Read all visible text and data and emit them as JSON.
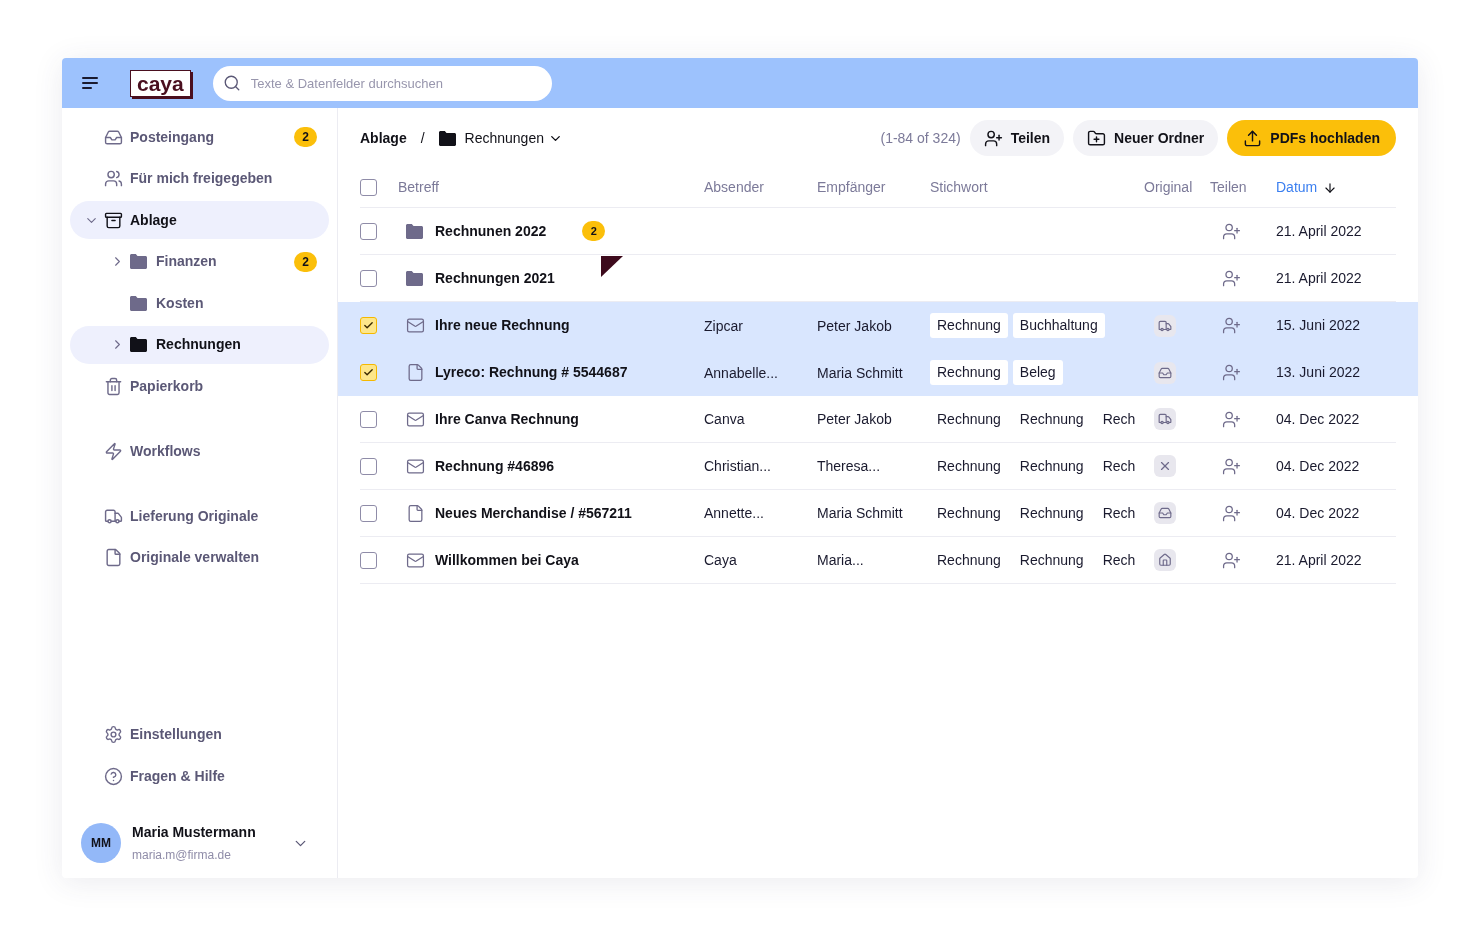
{
  "header": {
    "logo": "caya",
    "search": {
      "placeholder": "Texte & Datenfelder durchsuchen"
    }
  },
  "sidebar": {
    "sections": [
      {
        "items": [
          {
            "kind": "inbox",
            "label": "Posteingang",
            "badge": "2",
            "selected": false
          },
          {
            "kind": "users",
            "label": "Für mich freigegeben",
            "selected": false
          },
          {
            "kind": "archive",
            "label": "Ablage",
            "selected": true,
            "expanded": true,
            "children": [
              {
                "kind": "folder",
                "label": "Finanzen",
                "badge": "2",
                "selected": false,
                "expanded": false
              },
              {
                "kind": "folder",
                "label": "Kosten",
                "selected": false
              },
              {
                "kind": "folder",
                "label": "Rechnungen",
                "selected": true,
                "expanded": false
              }
            ]
          },
          {
            "kind": "trash",
            "label": "Papierkorb",
            "selected": false
          }
        ]
      },
      {
        "items": [
          {
            "kind": "bolt",
            "label": "Workflows",
            "selected": false
          }
        ]
      },
      {
        "items": [
          {
            "kind": "truck",
            "label": "Lieferung Originale",
            "selected": false
          },
          {
            "kind": "file",
            "label": "Originale verwalten",
            "selected": false
          }
        ]
      },
      {
        "items": [
          {
            "kind": "settings",
            "label": "Einstellungen",
            "selected": false
          },
          {
            "kind": "help",
            "label": "Fragen & Hilfe",
            "selected": false
          }
        ],
        "kind": "footer"
      }
    ],
    "user": {
      "initials": "MM",
      "name": "Maria Mustermann",
      "email": "maria.m@firma.de"
    }
  },
  "breadcrumb": {
    "root": "Ablage",
    "separator": "/",
    "current": "Rechnungen"
  },
  "count": "(1-84 of 324)",
  "actions": [
    {
      "kind": "share",
      "label": "Teilen"
    },
    {
      "kind": "new-folder",
      "label": "Neuer Ordner"
    },
    {
      "kind": "upload",
      "label": "PDFs hochladen"
    }
  ],
  "table": {
    "all_selected": false,
    "columns": [
      {
        "label": "Betreff",
        "sorted": false
      },
      {
        "label": "Absender",
        "sorted": false
      },
      {
        "label": "Empfänger",
        "sorted": false
      },
      {
        "label": "Stichwort",
        "sorted": false
      },
      {
        "label": "Original",
        "sorted": false
      },
      {
        "label": "Teilen",
        "sorted": false
      },
      {
        "label": "Datum",
        "sorted": true
      }
    ],
    "rows": [
      {
        "kind": "folder",
        "selected": false,
        "subject": "Rechnunen 2022",
        "badge": "2",
        "date": "21. April 2022"
      },
      {
        "kind": "folder",
        "selected": false,
        "subject": "Rechnungen 2021",
        "date": "21. April 2022"
      },
      {
        "kind": "mail",
        "selected": true,
        "subject": "Ihre neue Rechnung",
        "sender": "Zipcar",
        "recipient": "Peter Jakob",
        "tags": [
          "Rechnung",
          "Buchhaltung"
        ],
        "original": {
          "kind": "truck"
        },
        "date": "15. Juni 2022"
      },
      {
        "kind": "file",
        "selected": true,
        "subject": "Lyreco: Rechnung # 5544687",
        "sender": "Annabelle...",
        "recipient": "Maria Schmitt",
        "tags": [
          "Rechnung",
          "Beleg"
        ],
        "original": {
          "kind": "inbox"
        },
        "date": "13. Juni 2022"
      },
      {
        "kind": "mail",
        "selected": false,
        "subject": "Ihre Canva Rechnung",
        "sender": "Canva",
        "recipient": "Peter Jakob",
        "tags": [
          "Rechnung",
          "Rechnung",
          "Rech"
        ],
        "original": {
          "kind": "truck"
        },
        "date": "04. Dec 2022"
      },
      {
        "kind": "mail",
        "selected": false,
        "subject": "Rechnung #46896",
        "sender": "Christian...",
        "recipient": "Theresa...",
        "tags": [
          "Rechnung",
          "Rechnung",
          "Rech"
        ],
        "original": {
          "kind": "cross"
        },
        "date": "04. Dec 2022"
      },
      {
        "kind": "file",
        "selected": false,
        "subject": "Neues Merchandise / #567211",
        "sender": "Annette...",
        "recipient": "Maria Schmitt",
        "tags": [
          "Rechnung",
          "Rechnung",
          "Rech"
        ],
        "original": {
          "kind": "inbox"
        },
        "date": "04. Dec 2022"
      },
      {
        "kind": "mail",
        "selected": false,
        "subject": "Willkommen bei Caya",
        "sender": "Caya",
        "recipient": "Maria...",
        "tags": [
          "Rechnung",
          "Rechnung",
          "Rech"
        ],
        "original": {
          "kind": "home"
        },
        "date": "21. April 2022"
      }
    ]
  }
}
